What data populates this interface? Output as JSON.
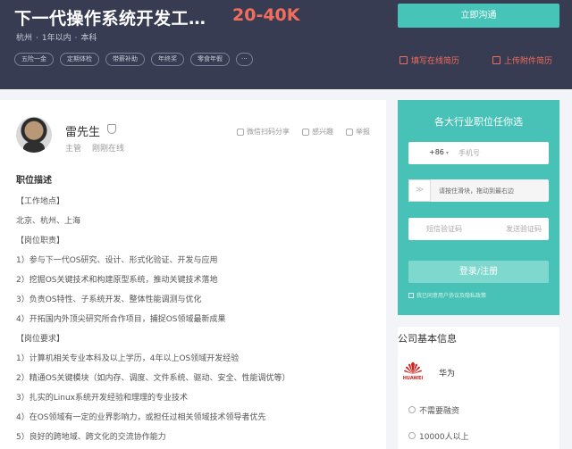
{
  "header": {
    "job_title": "下一代操作系统开发工…",
    "salary": "20-40K",
    "meta": {
      "city": "杭州",
      "experience": "1年以内",
      "education": "本科"
    },
    "tags": [
      "五险一金",
      "定期体检",
      "带薪补助",
      "年终奖",
      "零食年假",
      "···"
    ],
    "chat_button": "立即沟通",
    "fill_resume": "填写在线简历",
    "upload_resume": "上传附件简历"
  },
  "recruiter": {
    "name": "雷先生",
    "title": "主管",
    "status": "刚刚在线",
    "actions": {
      "share": "微信扫码分享",
      "interest": "感兴趣",
      "report": "举报"
    }
  },
  "job": {
    "section_title": "职位描述",
    "lines": [
      "【工作地点】",
      "北京、杭州、上海",
      "【岗位职责】",
      "1）参与下一代OS研究、设计、形式化验证、开发与应用",
      "2）挖掘OS关键技术和构建原型系统，推动关键技术落地",
      "3）负责OS特性、子系统开发、整体性能调测与优化",
      "4）开拓国内外顶尖研究所合作项目，捕捉OS领域最新成果",
      "【岗位要求】",
      "1）计算机相关专业本科及以上学历，4年以上OS领域开发经验",
      "2）精通OS关键模块（如内存、调度、文件系统、驱动、安全、性能调优等）",
      "3）扎实的Linux系统开发经验和理理的专业技术",
      "4）在OS领域有一定的业界影响力，或担任过相关领域技术领导者优先",
      "5）良好的跨地域、跨文化的交流协作能力"
    ]
  },
  "login": {
    "title": "各大行业职位任你选",
    "country_code": "+86",
    "phone_placeholder": "手机号",
    "slider_text": "请按住滑块，拖动到最右边",
    "slider_knob": "≫",
    "code_placeholder": "短信验证码",
    "send_code": "发送验证码",
    "submit": "登录/注册",
    "agreement": "我已同意用户协议及隐私政策"
  },
  "company": {
    "title": "公司基本信息",
    "logo_text": "HUAWEI",
    "name": "华为",
    "funding": "不需要融资",
    "size": "10000人以上"
  },
  "colors": {
    "accent": "#46c4b8",
    "salary": "#f26d5b",
    "header_bg": "#383c52"
  }
}
